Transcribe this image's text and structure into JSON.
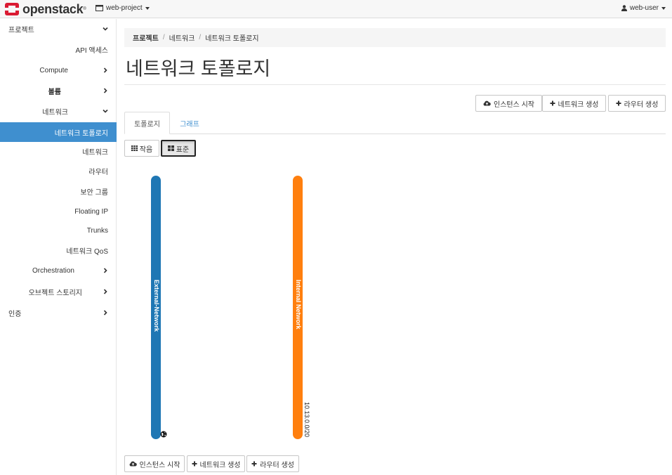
{
  "navbar": {
    "brand": "openstack",
    "project": "web-project",
    "user": "web-user"
  },
  "sidebar": {
    "items": [
      {
        "label": "프로젝트",
        "chevron": "down"
      },
      {
        "label": "API 액세스"
      },
      {
        "label": "Compute",
        "chevron": "right"
      },
      {
        "label": "볼륨",
        "chevron": "right"
      },
      {
        "label": "네트워크",
        "chevron": "down"
      },
      {
        "label": "네트워크 토폴로지",
        "active": true
      },
      {
        "label": "네트워크"
      },
      {
        "label": "라우터"
      },
      {
        "label": "보안 그룹"
      },
      {
        "label": "Floating IP"
      },
      {
        "label": "Trunks"
      },
      {
        "label": "네트워크 QoS"
      },
      {
        "label": "Orchestration",
        "chevron": "right"
      },
      {
        "label": "오브젝트 스토리지",
        "chevron": "right"
      },
      {
        "label": "인증",
        "chevron": "right"
      }
    ]
  },
  "breadcrumb": [
    "프로젝트",
    "네트워크",
    "네트워크 토폴로지"
  ],
  "page_title": "네트워크 토폴로지",
  "actions": {
    "launch_instance": "인스턴스 시작",
    "create_network": "네트워크 생성",
    "create_router": "라우터 생성"
  },
  "tabs": [
    "토폴로지",
    "그래프"
  ],
  "view_toggle": {
    "compact": "작음",
    "normal": "표준"
  },
  "networks": [
    {
      "name": "External-Network",
      "color": "#1f77b4",
      "icon": "globe-icon"
    },
    {
      "name": "Internal Network",
      "color": "#ff7f0e",
      "cidr": "10.13.0.0/20"
    }
  ],
  "colors": {
    "accent": "#3f8fcf"
  }
}
